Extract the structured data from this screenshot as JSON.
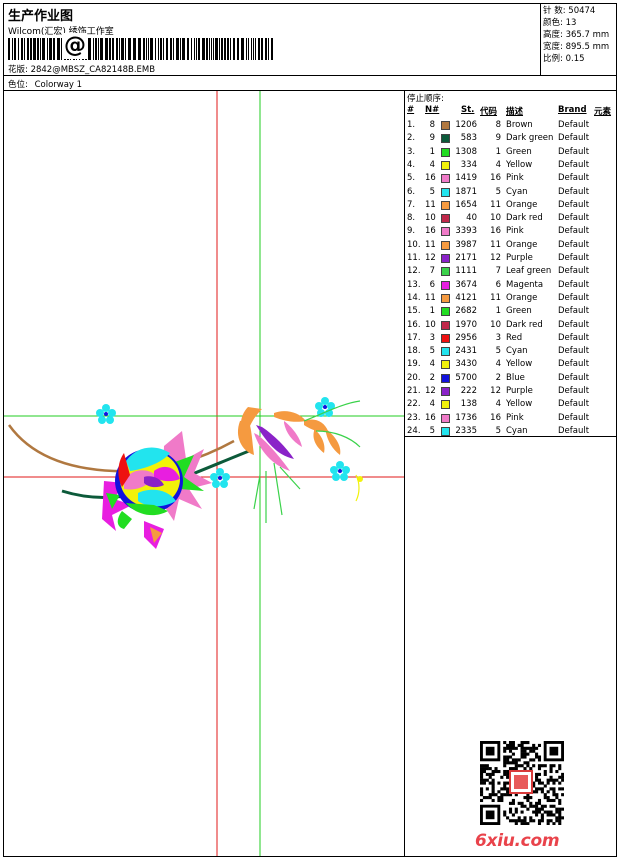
{
  "header": {
    "title": "生产作业图",
    "company": "Wilcom(汇宏) 绣饰工作室",
    "barcode_char": "@",
    "design_label": "花版:",
    "design_value": "2842@MBSZ_CA82148B.EMB",
    "colorway_label": "色位:",
    "colorway_value": "Colorway 1"
  },
  "stats": [
    {
      "label": "针 数:",
      "value": "50474"
    },
    {
      "label": "颜色:",
      "value": "13"
    },
    {
      "label": "高度:",
      "value": "365.7 mm"
    },
    {
      "label": "宽度:",
      "value": "895.5 mm"
    },
    {
      "label": "比例:",
      "value": "0.15"
    }
  ],
  "stop_sequence": {
    "title": "停止顺序:",
    "columns": [
      "#",
      "N#",
      "St.",
      "代码",
      "描述",
      "Brand",
      "元素"
    ],
    "rows": [
      {
        "seq": "1.",
        "needle": "8",
        "color": "#b07840",
        "stitches": "1206",
        "code": "8",
        "desc": "Brown",
        "brand": "Default"
      },
      {
        "seq": "2.",
        "needle": "9",
        "color": "#0c5a3a",
        "stitches": "583",
        "code": "9",
        "desc": "Dark green",
        "brand": "Default"
      },
      {
        "seq": "3.",
        "needle": "1",
        "color": "#22dd22",
        "stitches": "1308",
        "code": "1",
        "desc": "Green",
        "brand": "Default"
      },
      {
        "seq": "4.",
        "needle": "4",
        "color": "#f2f20a",
        "stitches": "334",
        "code": "4",
        "desc": "Yellow",
        "brand": "Default"
      },
      {
        "seq": "5.",
        "needle": "16",
        "color": "#f07ac8",
        "stitches": "1419",
        "code": "16",
        "desc": "Pink",
        "brand": "Default"
      },
      {
        "seq": "6.",
        "needle": "5",
        "color": "#22e4ee",
        "stitches": "1871",
        "code": "5",
        "desc": "Cyan",
        "brand": "Default"
      },
      {
        "seq": "7.",
        "needle": "11",
        "color": "#f59a40",
        "stitches": "1654",
        "code": "11",
        "desc": "Orange",
        "brand": "Default"
      },
      {
        "seq": "8.",
        "needle": "10",
        "color": "#c0284a",
        "stitches": "40",
        "code": "10",
        "desc": "Dark red",
        "brand": "Default"
      },
      {
        "seq": "9.",
        "needle": "16",
        "color": "#f07ac8",
        "stitches": "3393",
        "code": "16",
        "desc": "Pink",
        "brand": "Default"
      },
      {
        "seq": "10.",
        "needle": "11",
        "color": "#f59a40",
        "stitches": "3987",
        "code": "11",
        "desc": "Orange",
        "brand": "Default"
      },
      {
        "seq": "11.",
        "needle": "12",
        "color": "#8a22c8",
        "stitches": "2171",
        "code": "12",
        "desc": "Purple",
        "brand": "Default"
      },
      {
        "seq": "12.",
        "needle": "7",
        "color": "#3ad24a",
        "stitches": "1111",
        "code": "7",
        "desc": "Leaf green",
        "brand": "Default"
      },
      {
        "seq": "13.",
        "needle": "6",
        "color": "#e81ee0",
        "stitches": "3674",
        "code": "6",
        "desc": "Magenta",
        "brand": "Default"
      },
      {
        "seq": "14.",
        "needle": "11",
        "color": "#f59a40",
        "stitches": "4121",
        "code": "11",
        "desc": "Orange",
        "brand": "Default"
      },
      {
        "seq": "15.",
        "needle": "1",
        "color": "#22dd22",
        "stitches": "2682",
        "code": "1",
        "desc": "Green",
        "brand": "Default"
      },
      {
        "seq": "16.",
        "needle": "10",
        "color": "#c0284a",
        "stitches": "1970",
        "code": "10",
        "desc": "Dark red",
        "brand": "Default"
      },
      {
        "seq": "17.",
        "needle": "3",
        "color": "#ee1111",
        "stitches": "2956",
        "code": "3",
        "desc": "Red",
        "brand": "Default"
      },
      {
        "seq": "18.",
        "needle": "5",
        "color": "#22e4ee",
        "stitches": "2431",
        "code": "5",
        "desc": "Cyan",
        "brand": "Default"
      },
      {
        "seq": "19.",
        "needle": "4",
        "color": "#f2f20a",
        "stitches": "3430",
        "code": "4",
        "desc": "Yellow",
        "brand": "Default"
      },
      {
        "seq": "20.",
        "needle": "2",
        "color": "#1212dd",
        "stitches": "5700",
        "code": "2",
        "desc": "Blue",
        "brand": "Default"
      },
      {
        "seq": "21.",
        "needle": "12",
        "color": "#8a22c8",
        "stitches": "222",
        "code": "12",
        "desc": "Purple",
        "brand": "Default"
      },
      {
        "seq": "22.",
        "needle": "4",
        "color": "#f2f20a",
        "stitches": "138",
        "code": "4",
        "desc": "Yellow",
        "brand": "Default"
      },
      {
        "seq": "23.",
        "needle": "16",
        "color": "#f07ac8",
        "stitches": "1736",
        "code": "16",
        "desc": "Pink",
        "brand": "Default"
      },
      {
        "seq": "24.",
        "needle": "5",
        "color": "#22e4ee",
        "stitches": "2335",
        "code": "5",
        "desc": "Cyan",
        "brand": "Default"
      }
    ]
  },
  "footer": {
    "site": "6xiu.com",
    "qr_icon": "qr-code-icon"
  },
  "guide_colors": {
    "red": "#e01818",
    "green": "#22cc22"
  }
}
